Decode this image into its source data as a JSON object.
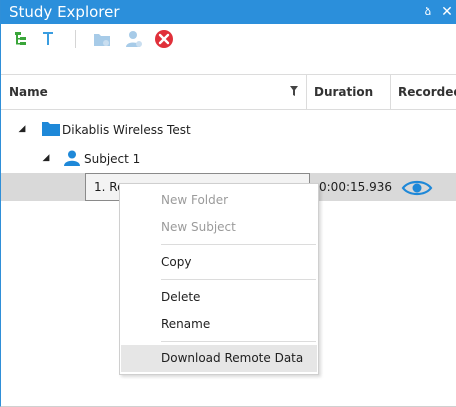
{
  "panel": {
    "title": "Study Explorer",
    "pin_glyph": "ձ",
    "close_glyph": "✕"
  },
  "toolbar": {
    "icons": [
      "expand-tree-icon",
      "filter-icon",
      "new-folder-icon",
      "new-subject-icon",
      "delete-icon"
    ]
  },
  "columns": {
    "name": "Name",
    "duration": "Duration",
    "recorded": "Recorded"
  },
  "tree": {
    "study": {
      "label": "Dikablis Wireless Test",
      "expander": "◢"
    },
    "subject": {
      "label": "Subject 1",
      "expander": "◢"
    },
    "recording": {
      "label_prefix": "1. Re",
      "duration": "0:00:15.936"
    }
  },
  "context_menu": {
    "new_folder": "New Folder",
    "new_subject": "New Subject",
    "copy": "Copy",
    "delete": "Delete",
    "rename": "Rename",
    "download_remote": "Download Remote Data"
  },
  "colors": {
    "accent": "#2b8fdb",
    "folder": "#1e88d8",
    "delete_red": "#e0303a"
  }
}
